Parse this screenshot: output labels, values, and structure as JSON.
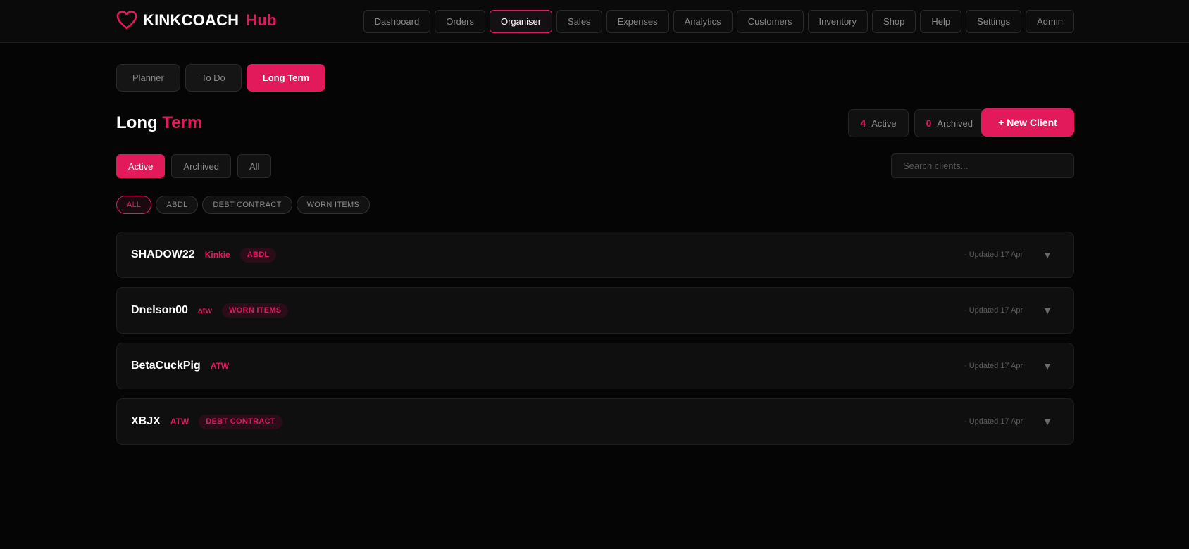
{
  "brand": {
    "name": "KINKCOACH",
    "accent": "Hub",
    "accent_color": "#e21a5c",
    "logo_icon": "heart-outline-icon"
  },
  "nav": [
    {
      "label": "Dashboard",
      "active": false
    },
    {
      "label": "Orders",
      "active": false
    },
    {
      "label": "Organiser",
      "active": true
    },
    {
      "label": "Sales",
      "active": false
    },
    {
      "label": "Expenses",
      "active": false
    },
    {
      "label": "Analytics",
      "active": false
    },
    {
      "label": "Customers",
      "active": false
    },
    {
      "label": "Inventory",
      "active": false
    },
    {
      "label": "Shop",
      "active": false
    },
    {
      "label": "Help",
      "active": false
    },
    {
      "label": "Settings",
      "active": false
    },
    {
      "label": "Admin",
      "active": false
    }
  ],
  "tabs": [
    {
      "label": "Planner",
      "active": false
    },
    {
      "label": "To Do",
      "active": false
    },
    {
      "label": "Long Term",
      "active": true
    }
  ],
  "page": {
    "title_main": "Long",
    "title_accent": "Term"
  },
  "stats": {
    "active": {
      "value": "4",
      "label": "Active"
    },
    "archived": {
      "value": "0",
      "label": "Archived"
    }
  },
  "new_client_label": "+ New Client",
  "filters": [
    {
      "label": "Active",
      "active": true
    },
    {
      "label": "Archived",
      "active": false
    },
    {
      "label": "All",
      "active": false
    }
  ],
  "search": {
    "placeholder": "Search clients...",
    "value": ""
  },
  "chips": [
    {
      "label": "ALL",
      "active": true
    },
    {
      "label": "ABDL",
      "active": false
    },
    {
      "label": "DEBT CONTRACT",
      "active": false
    },
    {
      "label": "WORN ITEMS",
      "active": false
    }
  ],
  "clients": [
    {
      "name": "SHADOW22",
      "platform": "Kinkie",
      "tag": "ABDL",
      "updated": "· Updated 17 Apr"
    },
    {
      "name": "Dnelson00",
      "platform": "atw",
      "tag": "WORN ITEMS",
      "updated": "· Updated 17 Apr"
    },
    {
      "name": "BetaCuckPig",
      "platform": "ATW",
      "tag": "",
      "updated": "· Updated 17 Apr"
    },
    {
      "name": "XBJX",
      "platform": "ATW",
      "tag": "DEBT CONTRACT",
      "updated": "· Updated 17 Apr"
    }
  ]
}
